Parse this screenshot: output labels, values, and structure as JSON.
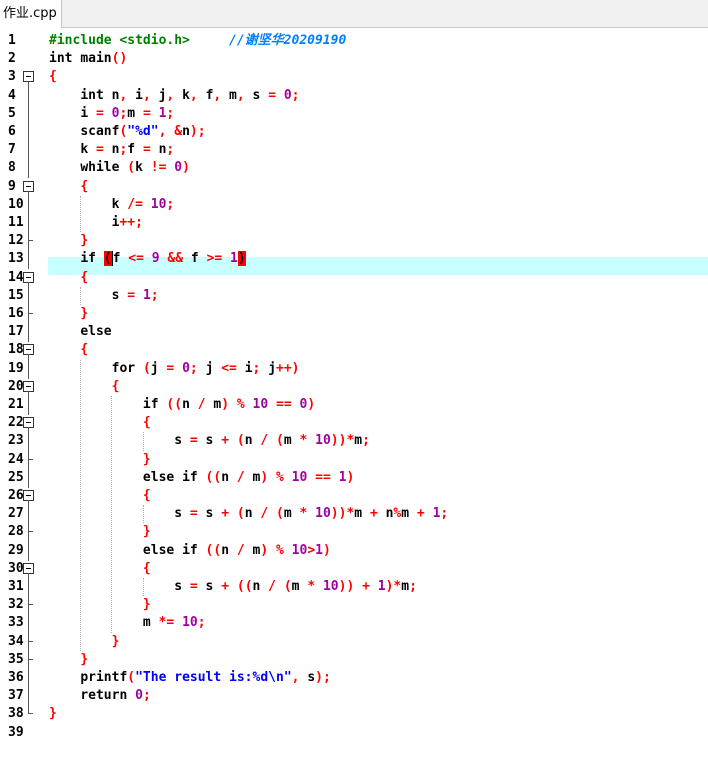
{
  "tab": {
    "label": "作业.cpp"
  },
  "editor": {
    "highlighted_line": 13,
    "lines": [
      {
        "n": "1",
        "code": "#include <stdio.h>     //谢坚华20209190"
      },
      {
        "n": "2",
        "code": "int main()"
      },
      {
        "n": "3",
        "code": "{"
      },
      {
        "n": "4",
        "code": "    int n, i, j, k, f, m, s = 0;"
      },
      {
        "n": "5",
        "code": "    i = 0;m = 1;"
      },
      {
        "n": "6",
        "code": "    scanf(\"%d\", &n);"
      },
      {
        "n": "7",
        "code": "    k = n;f = n;"
      },
      {
        "n": "8",
        "code": "    while (k != 0)"
      },
      {
        "n": "9",
        "code": "    {"
      },
      {
        "n": "10",
        "code": "        k /= 10;"
      },
      {
        "n": "11",
        "code": "        i++;"
      },
      {
        "n": "12",
        "code": "    }"
      },
      {
        "n": "13",
        "code": "    if (f <= 9 && f >= 1)"
      },
      {
        "n": "14",
        "code": "    {"
      },
      {
        "n": "15",
        "code": "        s = 1;"
      },
      {
        "n": "16",
        "code": "    }"
      },
      {
        "n": "17",
        "code": "    else"
      },
      {
        "n": "18",
        "code": "    {"
      },
      {
        "n": "19",
        "code": "        for (j = 0; j <= i; j++)"
      },
      {
        "n": "20",
        "code": "        {"
      },
      {
        "n": "21",
        "code": "            if ((n / m) % 10 == 0)"
      },
      {
        "n": "22",
        "code": "            {"
      },
      {
        "n": "23",
        "code": "                s = s + (n / (m * 10))*m;"
      },
      {
        "n": "24",
        "code": "            }"
      },
      {
        "n": "25",
        "code": "            else if ((n / m) % 10 == 1)"
      },
      {
        "n": "26",
        "code": "            {"
      },
      {
        "n": "27",
        "code": "                s = s + (n / (m * 10))*m + n%m + 1;"
      },
      {
        "n": "28",
        "code": "            }"
      },
      {
        "n": "29",
        "code": "            else if ((n / m) % 10>1)"
      },
      {
        "n": "30",
        "code": "            {"
      },
      {
        "n": "31",
        "code": "                s = s + ((n / (m * 10)) + 1)*m;"
      },
      {
        "n": "32",
        "code": "            }"
      },
      {
        "n": "33",
        "code": "            m *= 10;"
      },
      {
        "n": "34",
        "code": "        }"
      },
      {
        "n": "35",
        "code": "    }"
      },
      {
        "n": "36",
        "code": "    printf(\"The result is:%d\\n\", s);"
      },
      {
        "n": "37",
        "code": "    return 0;"
      },
      {
        "n": "38",
        "code": "}"
      },
      {
        "n": "39",
        "code": ""
      }
    ]
  },
  "colors": {
    "keyword": "#000000",
    "preprocessor": "#008000",
    "comment": "#0080ff",
    "operator": "#ff0000",
    "number": "#a000a0",
    "string": "#0000ff",
    "current_line": "#c8ffff",
    "brace_match": "#ff0000"
  }
}
